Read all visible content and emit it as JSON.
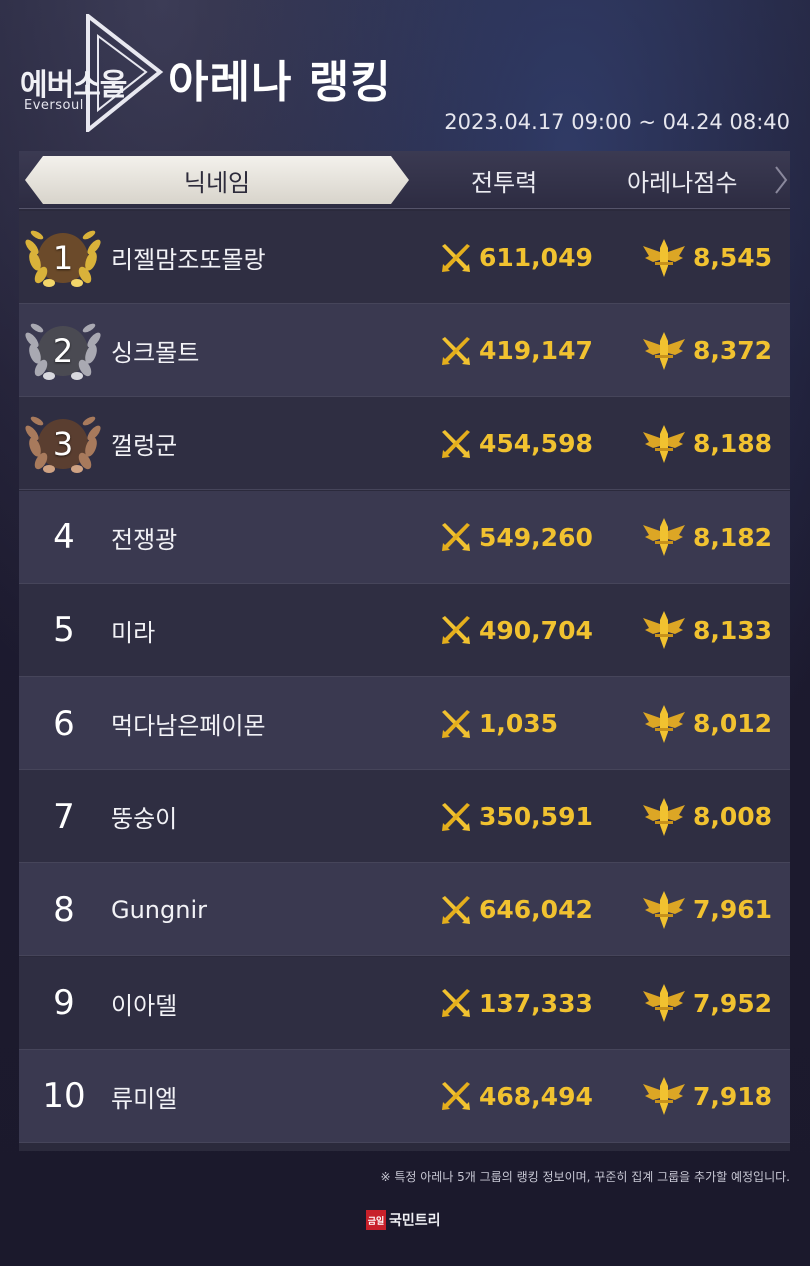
{
  "header": {
    "logo_kr": "에버소울",
    "logo_en": "Eversoul",
    "title": "아레나 랭킹",
    "period": "2023.04.17 09:00 ~ 04.24 08:40"
  },
  "table": {
    "columns": {
      "nickname": "닉네임",
      "power": "전투력",
      "score": "아레나점수"
    },
    "rows": [
      {
        "rank": "1",
        "name": "리젤맘조또몰랑",
        "power": "611,049",
        "score": "8,545",
        "medal": "gold"
      },
      {
        "rank": "2",
        "name": "싱크몰트",
        "power": "419,147",
        "score": "8,372",
        "medal": "silver"
      },
      {
        "rank": "3",
        "name": "껄렁군",
        "power": "454,598",
        "score": "8,188",
        "medal": "bronze"
      },
      {
        "rank": "4",
        "name": "전쟁광",
        "power": "549,260",
        "score": "8,182"
      },
      {
        "rank": "5",
        "name": "미라",
        "power": "490,704",
        "score": "8,133"
      },
      {
        "rank": "6",
        "name": "먹다남은페이몬",
        "power": "1,035",
        "score": "8,012"
      },
      {
        "rank": "7",
        "name": "뚱숭이",
        "power": "350,591",
        "score": "8,008"
      },
      {
        "rank": "8",
        "name": "Gungnir",
        "power": "646,042",
        "score": "7,961"
      },
      {
        "rank": "9",
        "name": "이아델",
        "power": "137,333",
        "score": "7,952"
      },
      {
        "rank": "10",
        "name": "류미엘",
        "power": "468,494",
        "score": "7,918"
      }
    ]
  },
  "footnote": "※ 특정 아레나 5개 그룹의 랭킹 정보이며, 꾸준히 집계 그룹을 추가할 예정입니다.",
  "brand": {
    "mark": "금일",
    "name": "국민트리"
  },
  "colors": {
    "gold": "#f1c230",
    "silver": "#b9b9c2",
    "bronze": "#b8876a",
    "background": "#1c1a2e"
  },
  "icons": {
    "power": "crossed-swords-icon",
    "score": "winged-sword-emblem-icon",
    "medal": "laurel-wreath-icon"
  }
}
